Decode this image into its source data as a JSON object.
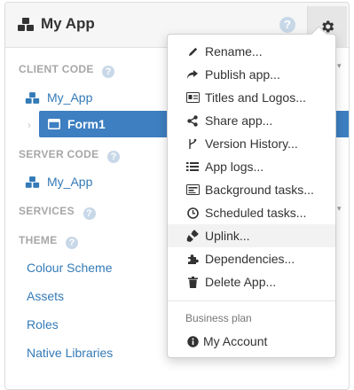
{
  "header": {
    "title": "My App",
    "help_glyph": "?",
    "settings_icon": "gear-icon"
  },
  "sidebar": {
    "client_code": {
      "label": "CLIENT CODE",
      "help_glyph": "?"
    },
    "client_items": [
      {
        "label": "My_App",
        "icon": "app-cubes-icon"
      },
      {
        "label": "Form1",
        "icon": "window-icon",
        "selected": true
      }
    ],
    "server_code": {
      "label": "SERVER CODE",
      "help_glyph": "?"
    },
    "server_items": [
      {
        "label": "My_App",
        "icon": "app-cubes-icon"
      }
    ],
    "services": {
      "label": "SERVICES",
      "help_glyph": "?"
    },
    "theme": {
      "label": "THEME",
      "help_glyph": "?"
    },
    "theme_items": [
      {
        "label": "Colour Scheme"
      },
      {
        "label": "Assets"
      },
      {
        "label": "Roles"
      },
      {
        "label": "Native Libraries"
      }
    ]
  },
  "menu": {
    "items": [
      {
        "label": "Rename...",
        "icon": "pencil-icon"
      },
      {
        "label": "Publish app...",
        "icon": "share-arrow-icon"
      },
      {
        "label": "Titles and Logos...",
        "icon": "id-card-icon"
      },
      {
        "label": "Share app...",
        "icon": "share-nodes-icon"
      },
      {
        "label": "Version History...",
        "icon": "branch-icon"
      },
      {
        "label": "App logs...",
        "icon": "list-icon"
      },
      {
        "label": "Background tasks...",
        "icon": "tasks-icon"
      },
      {
        "label": "Scheduled tasks...",
        "icon": "clock-icon"
      },
      {
        "label": "Uplink...",
        "icon": "plug-icon",
        "highlighted": true
      },
      {
        "label": "Dependencies...",
        "icon": "puzzle-icon"
      },
      {
        "label": "Delete App...",
        "icon": "trash-icon"
      }
    ],
    "section_header": "Business plan",
    "account_item": {
      "label": "My Account",
      "icon": "info-circle-icon"
    }
  },
  "colors": {
    "accent": "#337ab7",
    "selected_row": "#3d7fc1",
    "section_label": "#a7a7a7",
    "help_icon": "#c8d8e8"
  }
}
